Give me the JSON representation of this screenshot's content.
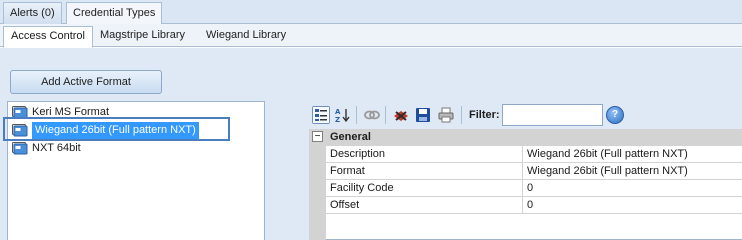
{
  "top_tabs": [
    {
      "label": "Alerts (0)",
      "active": false
    },
    {
      "label": "Credential Types",
      "active": true
    }
  ],
  "sub_tabs": [
    {
      "label": "Access Control",
      "active": true
    },
    {
      "label": "Magstripe Library",
      "active": false
    },
    {
      "label": "Wiegand Library",
      "active": false
    }
  ],
  "add_button_label": "Add Active Format",
  "formats": [
    {
      "label": "Keri MS Format",
      "icon": "card-format-icon"
    },
    {
      "label": "Wiegand 26bit (Full pattern NXT)",
      "icon": "card-format-icon",
      "selected": true
    },
    {
      "label": "NXT 64bit",
      "icon": "card-format-icon"
    }
  ],
  "toolbar": {
    "filter_label": "Filter:",
    "filter_value": "",
    "icons": [
      "categorized-icon",
      "sort-alphabetical-icon",
      "link-icon",
      "delete-icon",
      "save-icon",
      "print-icon",
      "help-icon"
    ]
  },
  "property_grid": {
    "group": "General",
    "rows": [
      {
        "name": "Description",
        "value": "Wiegand 26bit (Full pattern NXT)"
      },
      {
        "name": "Format",
        "value": "Wiegand 26bit (Full pattern NXT)"
      },
      {
        "name": "Facility Code",
        "value": "0"
      },
      {
        "name": "Offset",
        "value": "0"
      }
    ]
  },
  "colors": {
    "selection": "#3399ff",
    "panel_bg": "#dfe9f6",
    "focus_frame": "#4a7ec0"
  }
}
